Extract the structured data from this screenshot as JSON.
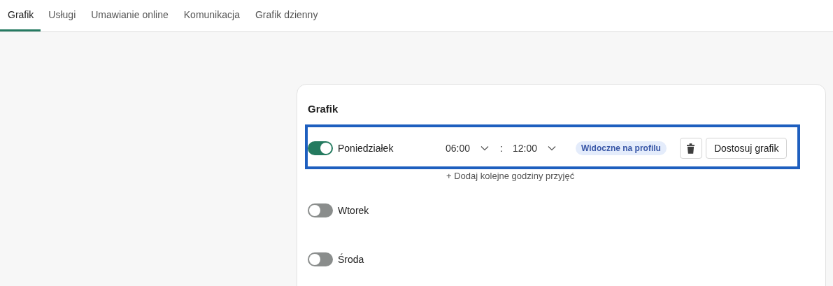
{
  "tabs": [
    {
      "label": "Grafik",
      "selected": true
    },
    {
      "label": "Usługi",
      "selected": false
    },
    {
      "label": "Umawianie online",
      "selected": false
    },
    {
      "label": "Komunikacja",
      "selected": false
    },
    {
      "label": "Grafik dzienny",
      "selected": false
    }
  ],
  "schedule": {
    "title": "Grafik",
    "days": [
      {
        "name": "Poniedziałek",
        "on": true,
        "highlighted": true,
        "ranges": [
          {
            "from": "06:00",
            "separator": ":",
            "to": "12:00"
          }
        ],
        "badge": "Widoczne na profilu",
        "customize_button": "Dostosuj grafik",
        "add_link": "+ Dodaj kolejne godziny przyjęć"
      },
      {
        "name": "Wtorek",
        "on": false,
        "highlighted": false
      },
      {
        "name": "Środa",
        "on": false,
        "highlighted": false
      }
    ]
  }
}
